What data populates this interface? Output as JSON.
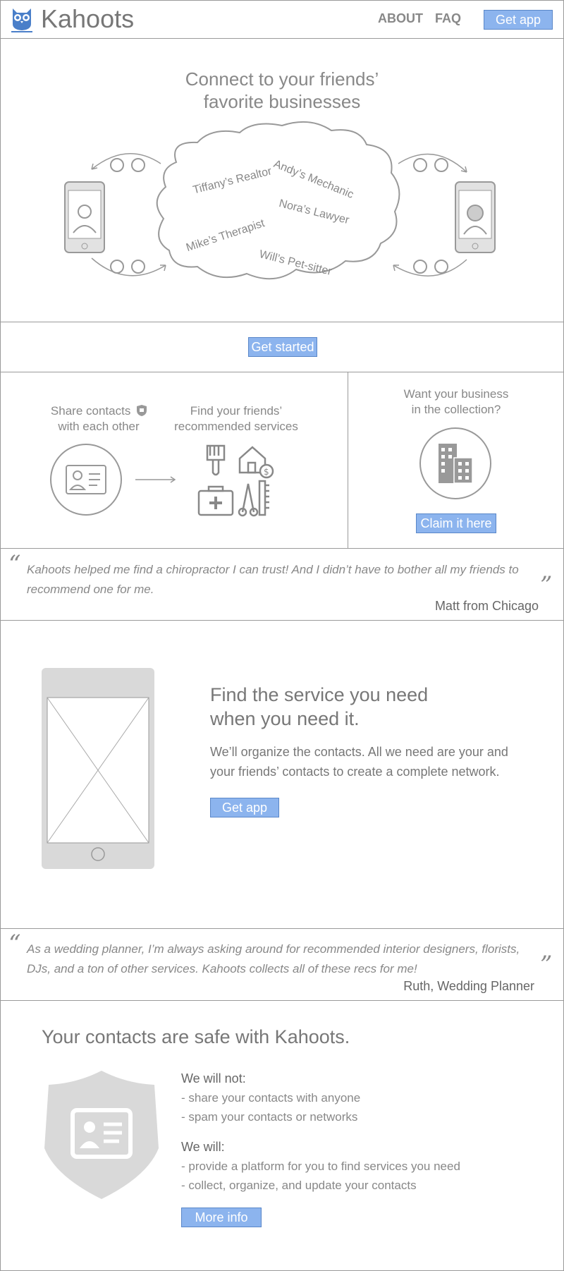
{
  "brand": {
    "name": "Kahoots"
  },
  "nav": {
    "about": "ABOUT",
    "faq": "FAQ",
    "get_app": "Get app"
  },
  "hero": {
    "title_line1": "Connect to your friends’",
    "title_line2": "favorite businesses",
    "cloud": [
      "Andy’s Mechanic",
      "Tiffany’s Realtor",
      "Nora’s Lawyer",
      "Mike’s Therapist",
      "Will’s Pet-sitter"
    ]
  },
  "cta": {
    "get_started": "Get started"
  },
  "how": {
    "share_line1": "Share contacts",
    "share_line2": "with each other",
    "find_line1": "Find your friends’",
    "find_line2": "recommended services",
    "business_line1": "Want your business",
    "business_line2": "in the collection?",
    "claim": "Claim it here"
  },
  "quote1": {
    "text": "Kahoots helped me find a chiropractor I can trust! And I didn’t have to bother all my friends to recommend one for me.",
    "author": "Matt from Chicago"
  },
  "feature": {
    "title_line1": "Find the service you need",
    "title_line2": "when you need it.",
    "body": "We’ll organize the contacts. All we need are your and your friends’ contacts to create a complete network.",
    "get_app": "Get app"
  },
  "quote2": {
    "text": "As a wedding planner, I’m always asking around for recommended interior designers, florists, DJs, and a ton of other services. Kahoots collects all of these recs for me!",
    "author": "Ruth, Wedding Planner"
  },
  "safety": {
    "title": "Your contacts are safe with Kahoots.",
    "will_not_heading": "We will not:",
    "will_not": [
      "- share your contacts with anyone",
      "- spam your contacts or networks"
    ],
    "will_heading": "We will:",
    "will": [
      "- provide a platform for you to find services you need",
      "- collect, organize, and update your contacts"
    ],
    "more_info": "More info"
  },
  "colors": {
    "accent": "#8cb4ee",
    "accent_border": "#5a87c8",
    "line": "#9a9a9a",
    "logo": "#4a7fc9"
  }
}
